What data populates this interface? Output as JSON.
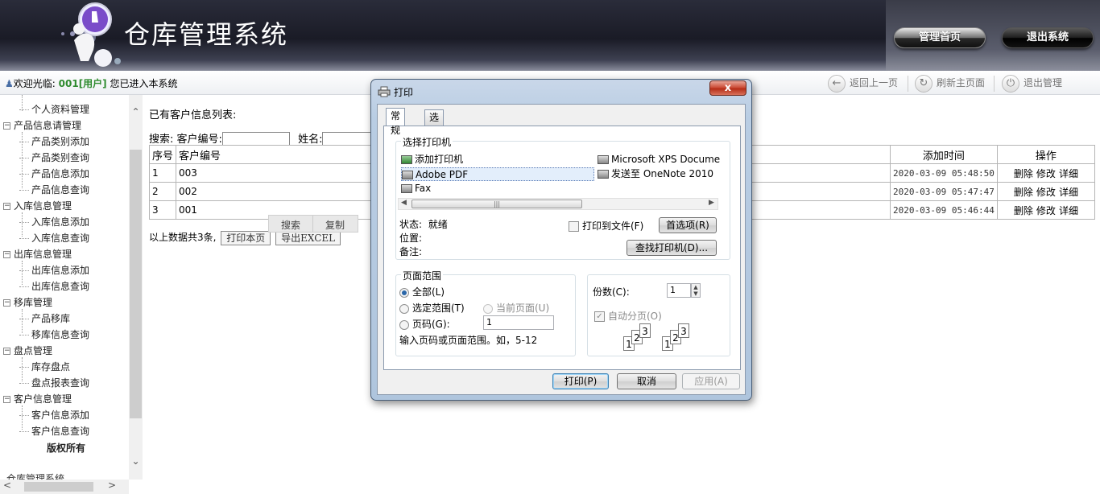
{
  "header": {
    "app_title": "仓库管理系统",
    "home_button": "管理首页",
    "logout_button": "退出系统"
  },
  "statusbar": {
    "welcome_prefix": "欢迎光临:",
    "user": "001[用户]",
    "welcome_suffix": "您已进入本系统",
    "back": "返回上一页",
    "refresh": "刷新主页面",
    "exit": "退出管理"
  },
  "sidebar": {
    "partial_item": "个人资料管理",
    "groups": [
      {
        "label": "产品信息请管理",
        "items": [
          "产品类别添加",
          "产品类别查询",
          "产品信息添加",
          "产品信息查询"
        ]
      },
      {
        "label": "入库信息管理",
        "items": [
          "入库信息添加",
          "入库信息查询"
        ]
      },
      {
        "label": "出库信息管理",
        "items": [
          "出库信息添加",
          "出库信息查询"
        ]
      },
      {
        "label": "移库管理",
        "items": [
          "产品移库",
          "移库信息查询"
        ]
      },
      {
        "label": "盘点管理",
        "items": [
          "库存盘点",
          "盘点报表查询"
        ]
      },
      {
        "label": "客户信息管理",
        "items": [
          "客户信息添加",
          "客户信息查询"
        ]
      }
    ],
    "copyright": "版权所有",
    "footer": "仓库管理系统"
  },
  "main": {
    "list_title": "已有客户信息列表:",
    "search_label": "搜索:",
    "customer_no_label": "客户编号:",
    "name_label": "姓名:",
    "columns": [
      "序号",
      "客户编号",
      "添加时间",
      "操作"
    ],
    "rows": [
      {
        "seq": "1",
        "code": "003",
        "time": "2020-03-09 05:48:50"
      },
      {
        "seq": "2",
        "code": "002",
        "time": "2020-03-09 05:47:47"
      },
      {
        "seq": "3",
        "code": "001",
        "time": "2020-03-09 05:46:44"
      }
    ],
    "row_actions": [
      "删除",
      "修改",
      "详细"
    ],
    "summary": "以上数据共3条,",
    "print_button": "打印本页",
    "export_button": "导出EXCEL",
    "context_menu": [
      "搜索",
      "复制"
    ]
  },
  "dialog": {
    "title": "打印",
    "close": "x",
    "tabs": [
      "常规",
      "选项"
    ],
    "select_printer_label": "选择打印机",
    "printers": [
      {
        "name": "添加打印机",
        "icon": "add-printer-icon"
      },
      {
        "name": "Microsoft XPS Docume",
        "icon": "printer-icon"
      },
      {
        "name": "Adobe PDF",
        "icon": "printer-icon",
        "selected": true
      },
      {
        "name": "发送至 OneNote 2010",
        "icon": "printer-icon"
      },
      {
        "name": "Fax",
        "icon": "fax-icon"
      }
    ],
    "status_label": "状态:",
    "status_value": "就绪",
    "location_label": "位置:",
    "comment_label": "备注:",
    "print_to_file": "打印到文件(F)",
    "preferences_button": "首选项(R)",
    "find_printer_button": "查找打印机(D)...",
    "page_range_label": "页面范围",
    "range_all": "全部(L)",
    "range_selection": "选定范围(T)",
    "range_current": "当前页面(U)",
    "range_pages": "页码(G):",
    "pages_value": "1",
    "range_hint": "输入页码或页面范围。如，5-12",
    "copies_label": "份数(C):",
    "copies_value": "1",
    "collate_label": "自动分页(O)",
    "print_button": "打印(P)",
    "cancel_button": "取消",
    "apply_button": "应用(A)"
  }
}
